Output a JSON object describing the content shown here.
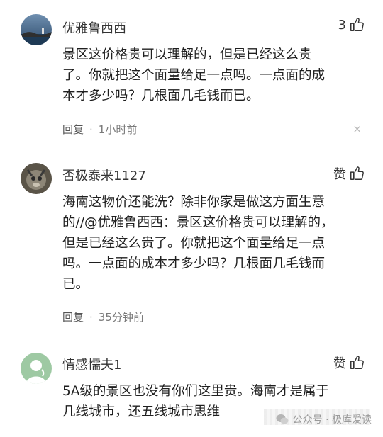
{
  "comments": [
    {
      "username": "优雅鲁西西",
      "likes": "3",
      "lines": [
        "景区这价格贵可以理解的，但是已经这么贵",
        "了。你就把这个面量给足一点吗。一点面的成",
        "本才多少吗？几根面几毛钱而已。"
      ],
      "reply_label": "回复",
      "time": "1小时前",
      "close": "×"
    },
    {
      "username": "否极泰来1127",
      "likes": "赞",
      "lines": [
        "海南这物价还能洗？除非你家是做这方面生意",
        "的//@优雅鲁西西：景区这价格贵可以理解的，",
        "但是已经这么贵了。你就把这个面量给足一点",
        "吗。一点面的成本才多少吗？几根面几毛钱而",
        "已。"
      ],
      "reply_label": "回复",
      "time": "35分钟前"
    },
    {
      "username": "情感懦夫1",
      "likes": "赞",
      "lines": [
        "5A级的景区也没有你们这里贵。海南才是属于",
        "几线城市，还五线城市思维"
      ]
    }
  ],
  "meta_separator": "·",
  "watermark": "公众号 · 极库爱读"
}
